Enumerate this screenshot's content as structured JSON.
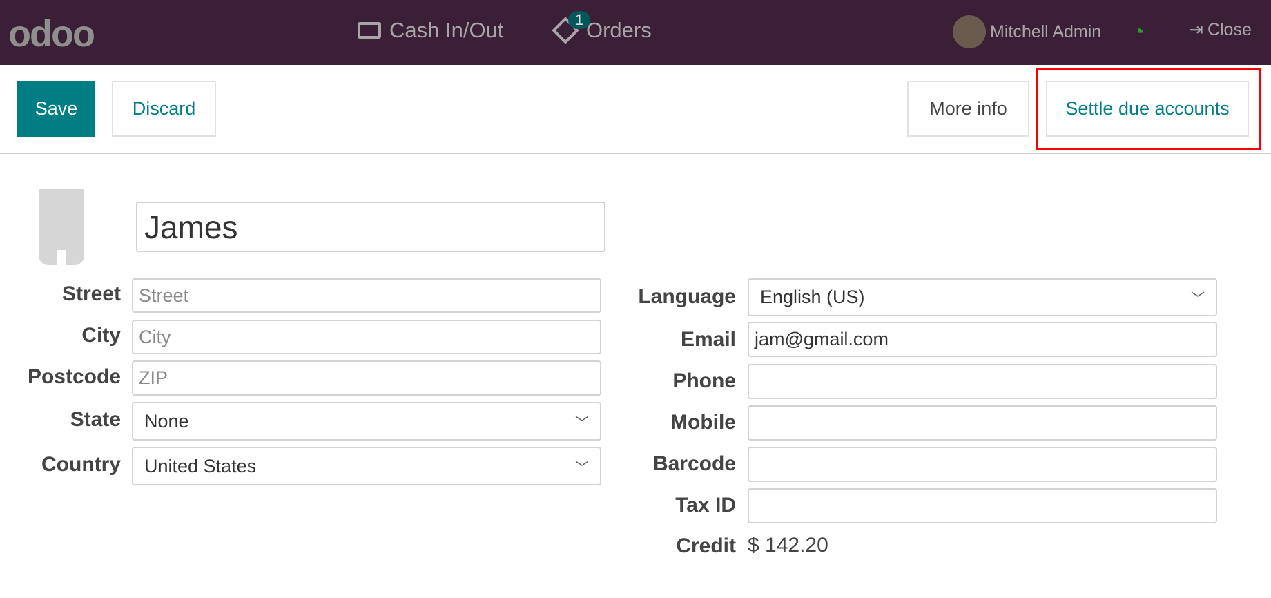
{
  "header": {
    "logo": "odoo",
    "cash": "Cash In/Out",
    "orders_badge": "1",
    "orders": "Orders",
    "user": "Mitchell Admin",
    "close": "Close"
  },
  "toolbar": {
    "save": "Save",
    "discard": "Discard",
    "more_info": "More info",
    "settle": "Settle due accounts"
  },
  "form": {
    "name": "James",
    "left": [
      {
        "label": "Street",
        "placeholder": "Street"
      },
      {
        "label": "City",
        "placeholder": "City"
      },
      {
        "label": "Postcode",
        "placeholder": "ZIP"
      }
    ],
    "state": {
      "label": "State",
      "value": "None"
    },
    "country": {
      "label": "Country",
      "value": "United States"
    },
    "language": {
      "label": "Language",
      "value": "English (US)"
    },
    "email": {
      "label": "Email",
      "value": "jam@gmail.com"
    },
    "right": [
      {
        "label": "Phone",
        "value": ""
      },
      {
        "label": "Mobile",
        "value": ""
      },
      {
        "label": "Barcode",
        "value": ""
      },
      {
        "label": "Tax ID",
        "value": ""
      }
    ],
    "credit": {
      "label": "Credit",
      "value": "$ 142.20"
    }
  },
  "colors": {
    "header": "#3b1f36",
    "accent": "#017e84",
    "highlight": "#ff0000"
  }
}
